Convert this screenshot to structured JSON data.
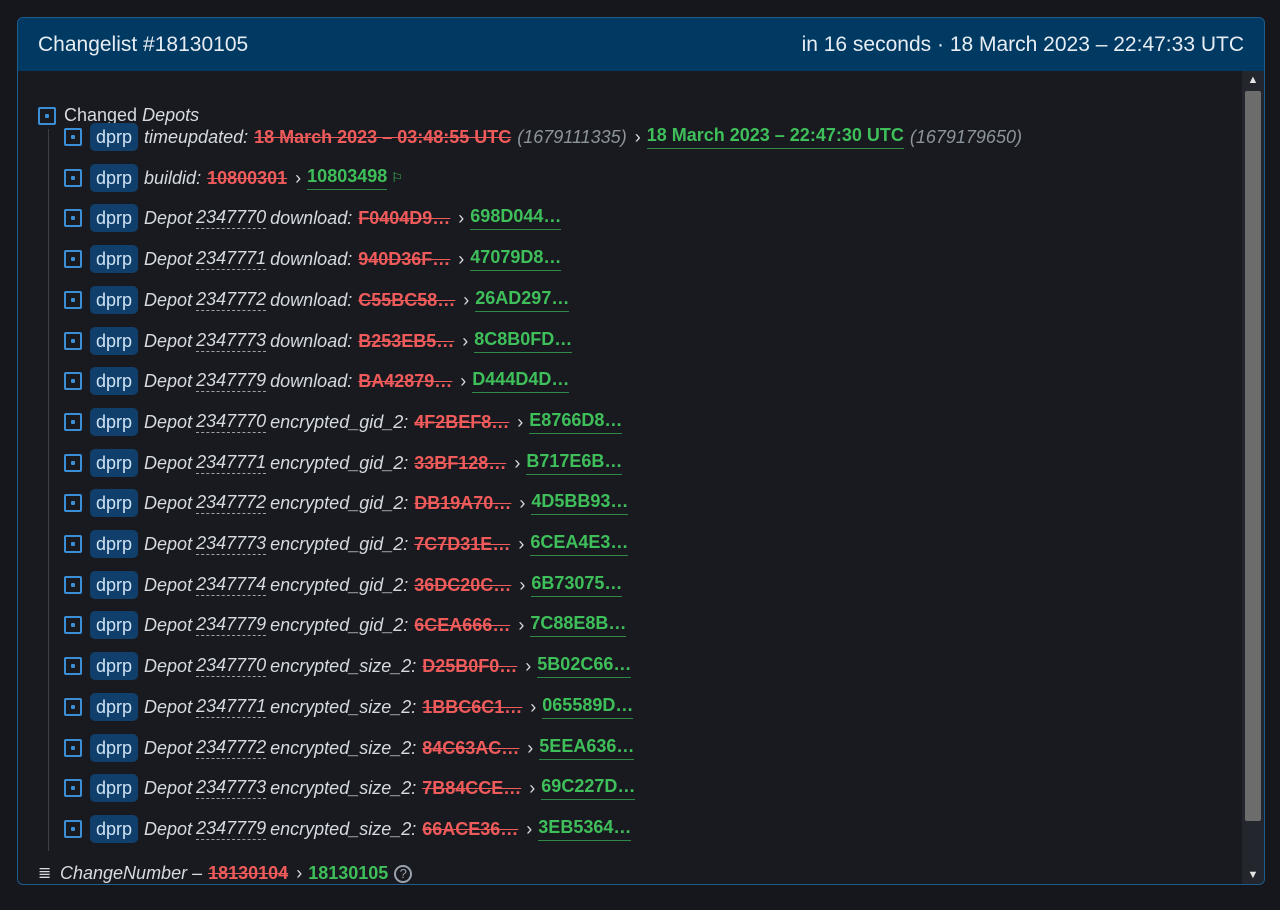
{
  "header": {
    "title": "Changelist #18130105",
    "time": "in 16 seconds · 18 March 2023 – 22:47:33 UTC"
  },
  "group": {
    "label_plain": "Changed ",
    "label_italic": "Depots"
  },
  "top_rows": [
    {
      "tag": "dprp",
      "key": "timeupdated:",
      "old": "18 March 2023 – 03:48:55 UTC",
      "old_raw": "(1679111335)",
      "arrow": "›",
      "new": "18 March 2023 – 22:47:30 UTC",
      "new_raw": "(1679179650)"
    },
    {
      "tag": "dprp",
      "key": "buildid:",
      "old": "10800301",
      "arrow": "›",
      "new": "10803498",
      "flag": "⚐"
    }
  ],
  "depot_rows": [
    {
      "tag": "dprp",
      "prefix": "Depot",
      "depot": "2347770",
      "field": "download:",
      "old": "F0404D9…",
      "arrow": "›",
      "new": "698D044…"
    },
    {
      "tag": "dprp",
      "prefix": "Depot",
      "depot": "2347771",
      "field": "download:",
      "old": "940D36F…",
      "arrow": "›",
      "new": "47079D8…"
    },
    {
      "tag": "dprp",
      "prefix": "Depot",
      "depot": "2347772",
      "field": "download:",
      "old": "C55BC58…",
      "arrow": "›",
      "new": "26AD297…"
    },
    {
      "tag": "dprp",
      "prefix": "Depot",
      "depot": "2347773",
      "field": "download:",
      "old": "B253EB5…",
      "arrow": "›",
      "new": "8C8B0FD…"
    },
    {
      "tag": "dprp",
      "prefix": "Depot",
      "depot": "2347779",
      "field": "download:",
      "old": "BA42879…",
      "arrow": "›",
      "new": "D444D4D…"
    },
    {
      "tag": "dprp",
      "prefix": "Depot",
      "depot": "2347770",
      "field": "encrypted_gid_2:",
      "old": "4F2BEF8…",
      "arrow": "›",
      "new": "E8766D8…"
    },
    {
      "tag": "dprp",
      "prefix": "Depot",
      "depot": "2347771",
      "field": "encrypted_gid_2:",
      "old": "33BF128…",
      "arrow": "›",
      "new": "B717E6B…"
    },
    {
      "tag": "dprp",
      "prefix": "Depot",
      "depot": "2347772",
      "field": "encrypted_gid_2:",
      "old": "DB19A70…",
      "arrow": "›",
      "new": "4D5BB93…"
    },
    {
      "tag": "dprp",
      "prefix": "Depot",
      "depot": "2347773",
      "field": "encrypted_gid_2:",
      "old": "7C7D31E…",
      "arrow": "›",
      "new": "6CEA4E3…"
    },
    {
      "tag": "dprp",
      "prefix": "Depot",
      "depot": "2347774",
      "field": "encrypted_gid_2:",
      "old": "36DC20C…",
      "arrow": "›",
      "new": "6B73075…"
    },
    {
      "tag": "dprp",
      "prefix": "Depot",
      "depot": "2347779",
      "field": "encrypted_gid_2:",
      "old": "6CEA666…",
      "arrow": "›",
      "new": "7C88E8B…"
    },
    {
      "tag": "dprp",
      "prefix": "Depot",
      "depot": "2347770",
      "field": "encrypted_size_2:",
      "old": "D25B0F0…",
      "arrow": "›",
      "new": "5B02C66…"
    },
    {
      "tag": "dprp",
      "prefix": "Depot",
      "depot": "2347771",
      "field": "encrypted_size_2:",
      "old": "1BBC6C1…",
      "arrow": "›",
      "new": "065589D…"
    },
    {
      "tag": "dprp",
      "prefix": "Depot",
      "depot": "2347772",
      "field": "encrypted_size_2:",
      "old": "84C63AC…",
      "arrow": "›",
      "new": "5EEA636…"
    },
    {
      "tag": "dprp",
      "prefix": "Depot",
      "depot": "2347773",
      "field": "encrypted_size_2:",
      "old": "7B84CCE…",
      "arrow": "›",
      "new": "69C227D…"
    },
    {
      "tag": "dprp",
      "prefix": "Depot",
      "depot": "2347779",
      "field": "encrypted_size_2:",
      "old": "66ACE36…",
      "arrow": "›",
      "new": "3EB5364…"
    }
  ],
  "footer": {
    "key": "ChangeNumber –",
    "old": "18130104",
    "arrow": "›",
    "new": "18130105",
    "help": "?"
  },
  "scrollbar": {
    "up": "▲",
    "down": "▼"
  },
  "colors": {
    "header_bg": "#003a63",
    "removed": "#ef5a5a",
    "added": "#3fbf5a",
    "tag_bg": "#0f3f6a"
  }
}
